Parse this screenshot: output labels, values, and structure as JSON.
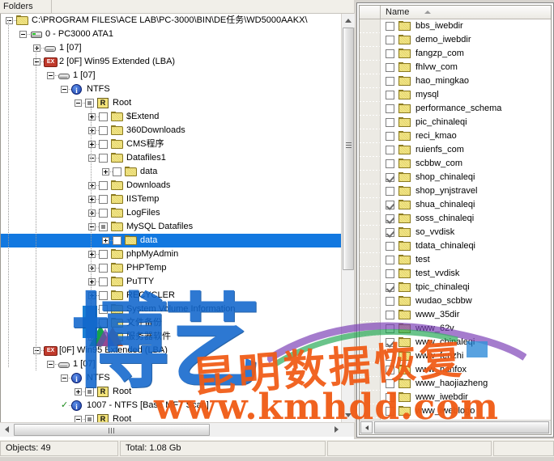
{
  "app": {
    "left_panel_title": "Folders",
    "status": {
      "objects": "Objects: 49",
      "total": "Total: 1.08 Gb",
      "cell3": "",
      "cell4": ""
    }
  },
  "tree": {
    "nodes": [
      {
        "label": "C:\\PROGRAM FILES\\ACE LAB\\PC-3000\\BIN\\DE任务\\WD5000AAKX\\",
        "depth": 0,
        "expander": "minus",
        "icon": "folders-root-icon",
        "checkbox": "none",
        "selected": false
      },
      {
        "label": "0 - PC3000 ATA1",
        "depth": 1,
        "expander": "minus",
        "icon": "disk-icon",
        "checkbox": "none",
        "selected": false
      },
      {
        "label": "1 [07]",
        "depth": 2,
        "expander": "plus",
        "icon": "partition-icon",
        "checkbox": "none",
        "selected": false
      },
      {
        "label": "2 [0F] Win95 Extended  (LBA)",
        "depth": 2,
        "expander": "minus",
        "icon": "extended-partition-icon",
        "checkbox": "none",
        "selected": false
      },
      {
        "label": "1 [07]",
        "depth": 3,
        "expander": "minus",
        "icon": "partition-icon",
        "checkbox": "none",
        "selected": false
      },
      {
        "label": "NTFS",
        "depth": 4,
        "expander": "minus",
        "icon": "info-icon",
        "checkbox": "none",
        "selected": false
      },
      {
        "label": "Root",
        "depth": 5,
        "expander": "minus",
        "icon": "r-badge-icon",
        "checkbox": "grey",
        "selected": false
      },
      {
        "label": "$Extend",
        "depth": 6,
        "expander": "plus",
        "icon": "folder-icon",
        "checkbox": "empty",
        "selected": false
      },
      {
        "label": "360Downloads",
        "depth": 6,
        "expander": "plus",
        "icon": "folder-icon",
        "checkbox": "empty",
        "selected": false
      },
      {
        "label": "CMS程序",
        "depth": 6,
        "expander": "plus",
        "icon": "folder-icon",
        "checkbox": "empty",
        "selected": false
      },
      {
        "label": "Datafiles1",
        "depth": 6,
        "expander": "minus",
        "icon": "folder-icon",
        "checkbox": "empty",
        "selected": false
      },
      {
        "label": "data",
        "depth": 7,
        "expander": "plus",
        "icon": "folder-icon",
        "checkbox": "empty",
        "selected": false
      },
      {
        "label": "Downloads",
        "depth": 6,
        "expander": "plus",
        "icon": "folder-icon",
        "checkbox": "empty",
        "selected": false
      },
      {
        "label": "IISTemp",
        "depth": 6,
        "expander": "plus",
        "icon": "folder-icon",
        "checkbox": "empty",
        "selected": false
      },
      {
        "label": "LogFiles",
        "depth": 6,
        "expander": "plus",
        "icon": "folder-icon",
        "checkbox": "empty",
        "selected": false
      },
      {
        "label": "MySQL Datafiles",
        "depth": 6,
        "expander": "minus",
        "icon": "folder-icon",
        "checkbox": "grey",
        "selected": false
      },
      {
        "label": "data",
        "depth": 7,
        "expander": "plus",
        "icon": "folder-icon",
        "checkbox": "white",
        "selected": true
      },
      {
        "label": "phpMyAdmin",
        "depth": 6,
        "expander": "plus",
        "icon": "folder-icon",
        "checkbox": "empty",
        "selected": false
      },
      {
        "label": "PHPTemp",
        "depth": 6,
        "expander": "plus",
        "icon": "folder-icon",
        "checkbox": "empty",
        "selected": false
      },
      {
        "label": "PuTTY",
        "depth": 6,
        "expander": "plus",
        "icon": "folder-icon",
        "checkbox": "empty",
        "selected": false
      },
      {
        "label": "RECYCLER",
        "depth": 6,
        "expander": "plus",
        "icon": "folder-icon",
        "checkbox": "empty",
        "selected": false
      },
      {
        "label": "System Volume Information",
        "depth": 6,
        "expander": "plus",
        "icon": "folder-icon",
        "checkbox": "empty",
        "selected": false
      },
      {
        "label": "文件备份",
        "depth": 6,
        "expander": "plus",
        "icon": "folder-icon",
        "checkbox": "empty",
        "selected": false
      },
      {
        "label": "服务器软件",
        "depth": 6,
        "expander": "plus",
        "icon": "folder-icon",
        "checkbox": "empty",
        "selected": false
      },
      {
        "label": "[0F] Win95 Extended  (LBA)",
        "depth": 2,
        "expander": "minus",
        "icon": "extended-partition-icon",
        "checkbox": "none",
        "selected": false
      },
      {
        "label": "1 [07]",
        "depth": 3,
        "expander": "minus",
        "icon": "partition-icon",
        "checkbox": "none",
        "selected": false
      },
      {
        "label": "NTFS",
        "depth": 4,
        "expander": "minus",
        "icon": "info-icon",
        "checkbox": "none",
        "selected": false
      },
      {
        "label": "Root",
        "depth": 5,
        "expander": "plus",
        "icon": "r-badge-icon",
        "checkbox": "grey",
        "selected": false
      },
      {
        "label": "1007 - NTFS [Base MFT Scan]",
        "depth": 4,
        "expander": "check",
        "icon": "info-icon",
        "checkbox": "none",
        "selected": false
      },
      {
        "label": "Root",
        "depth": 5,
        "expander": "minus",
        "icon": "r-badge-icon",
        "checkbox": "grey",
        "selected": false
      }
    ]
  },
  "filelist": {
    "column_header": "Name",
    "sort_icon": "sort-ascending-icon",
    "rows": [
      {
        "name": "bbs_iwebdir",
        "checked": false
      },
      {
        "name": "demo_iwebdir",
        "checked": false
      },
      {
        "name": "fangzp_com",
        "checked": false
      },
      {
        "name": "fhlvw_com",
        "checked": false
      },
      {
        "name": "hao_mingkao",
        "checked": false
      },
      {
        "name": "mysql",
        "checked": false
      },
      {
        "name": "performance_schema",
        "checked": false
      },
      {
        "name": "pic_chinaleqi",
        "checked": false
      },
      {
        "name": "reci_kmao",
        "checked": false
      },
      {
        "name": "ruienfs_com",
        "checked": false
      },
      {
        "name": "scbbw_com",
        "checked": false
      },
      {
        "name": "shop_chinaleqi",
        "checked": true
      },
      {
        "name": "shop_ynjstravel",
        "checked": false
      },
      {
        "name": "shua_chinaleqi",
        "checked": true
      },
      {
        "name": "soss_chinaleqi",
        "checked": true
      },
      {
        "name": "so_vvdisk",
        "checked": true
      },
      {
        "name": "tdata_chinaleqi",
        "checked": false
      },
      {
        "name": "test",
        "checked": false
      },
      {
        "name": "test_vvdisk",
        "checked": false
      },
      {
        "name": "tpic_chinaleqi",
        "checked": true
      },
      {
        "name": "wudao_scbbw",
        "checked": false
      },
      {
        "name": "www_35dir",
        "checked": false
      },
      {
        "name": "www_62v",
        "checked": false
      },
      {
        "name": "www_chinaleqi",
        "checked": true
      },
      {
        "name": "www_fenzhi",
        "checked": false
      },
      {
        "name": "www_nanfox",
        "checked": false
      },
      {
        "name": "www_haojiazheng",
        "checked": false
      },
      {
        "name": "www_iwebdir",
        "checked": false
      },
      {
        "name": "www_iweblogo",
        "checked": false
      }
    ]
  },
  "watermark": {
    "blue_text": "博艺",
    "red_text_cn": "昆明数据恢复",
    "red_text_url": "www.kmhdd.com"
  },
  "colors": {
    "selection": "#1278e0",
    "watermark_blue": "#1166cc",
    "watermark_red": "#f05a14",
    "folder_yellow": "#e8d87a",
    "chrome": "#d6d3ce"
  }
}
